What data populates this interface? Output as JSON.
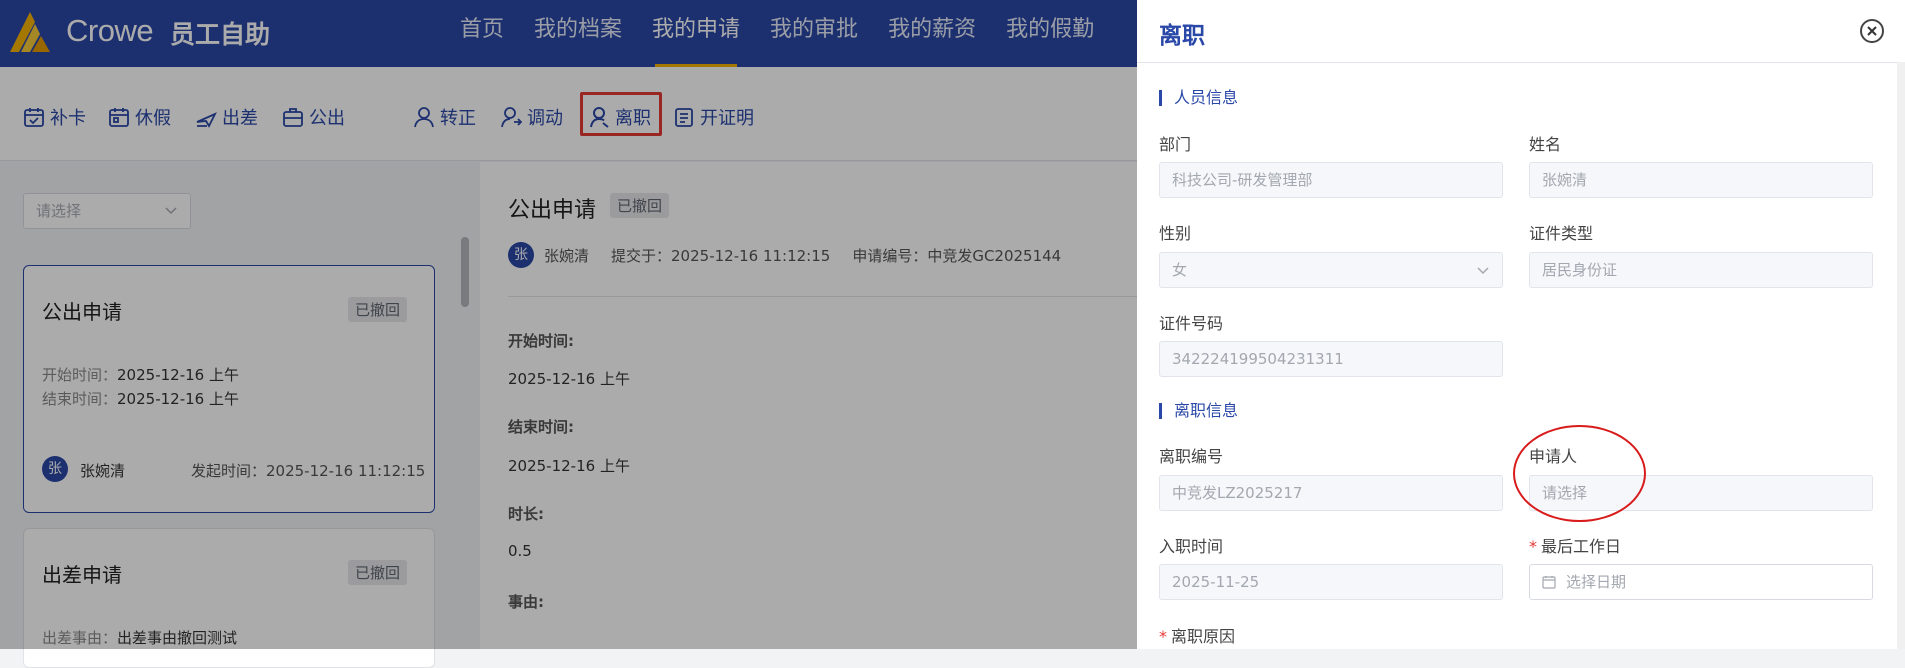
{
  "header": {
    "brand": "Crowe",
    "subtitle": "员工自助",
    "nav": [
      "首页",
      "我的档案",
      "我的申请",
      "我的审批",
      "我的薪资",
      "我的假勤"
    ],
    "active_index": 2
  },
  "toolbar": {
    "items": [
      "补卡",
      "休假",
      "出差",
      "公出",
      "转正",
      "调动",
      "离职",
      "开证明"
    ],
    "highlighted": "离职"
  },
  "list": {
    "select_placeholder": "请选择",
    "cards": [
      {
        "title": "公出申请",
        "status": "已撤回",
        "line1_label": "开始时间：",
        "line1_value": "2025-12-16 上午",
        "line2_label": "结束时间：",
        "line2_value": "2025-12-16 上午",
        "avatar": "张",
        "user": "张婉清",
        "time": "发起时间：2025-12-16 11:12:15"
      },
      {
        "title": "出差申请",
        "status": "已撤回",
        "line1_label": "出差事由：",
        "line1_value": "出差事由撤回测试"
      }
    ]
  },
  "detail": {
    "title": "公出申请",
    "status": "已撤回",
    "avatar": "张",
    "user": "张婉清",
    "submitted": "提交于：2025-12-16 11:12:15",
    "number": "申请编号：中竞发GC2025144",
    "fields": [
      {
        "label": "开始时间:",
        "value": "2025-12-16 上午"
      },
      {
        "label": "结束时间:",
        "value": "2025-12-16 上午"
      },
      {
        "label": "时长:",
        "value": "0.5"
      },
      {
        "label": "事由:",
        "value": ""
      }
    ]
  },
  "drawer": {
    "title": "离职",
    "section1": "人员信息",
    "dept_label": "部门",
    "dept_value": "科技公司-研发管理部",
    "name_label": "姓名",
    "name_value": "张婉清",
    "gender_label": "性别",
    "gender_value": "女",
    "idtype_label": "证件类型",
    "idtype_value": "居民身份证",
    "idno_label": "证件号码",
    "idno_value": "342224199504231311",
    "section2": "离职信息",
    "resign_no_label": "离职编号",
    "resign_no_value": "中竞发LZ2025217",
    "applicant_label": "申请人",
    "applicant_placeholder": "请选择",
    "join_label": "入职时间",
    "join_value": "2025-11-25",
    "lastday_label": "最后工作日",
    "lastday_placeholder": "选择日期",
    "reason_label": "离职原因"
  },
  "colors": {
    "primary": "#2a48a8",
    "accent": "#f5b400",
    "alert": "#e53935"
  }
}
